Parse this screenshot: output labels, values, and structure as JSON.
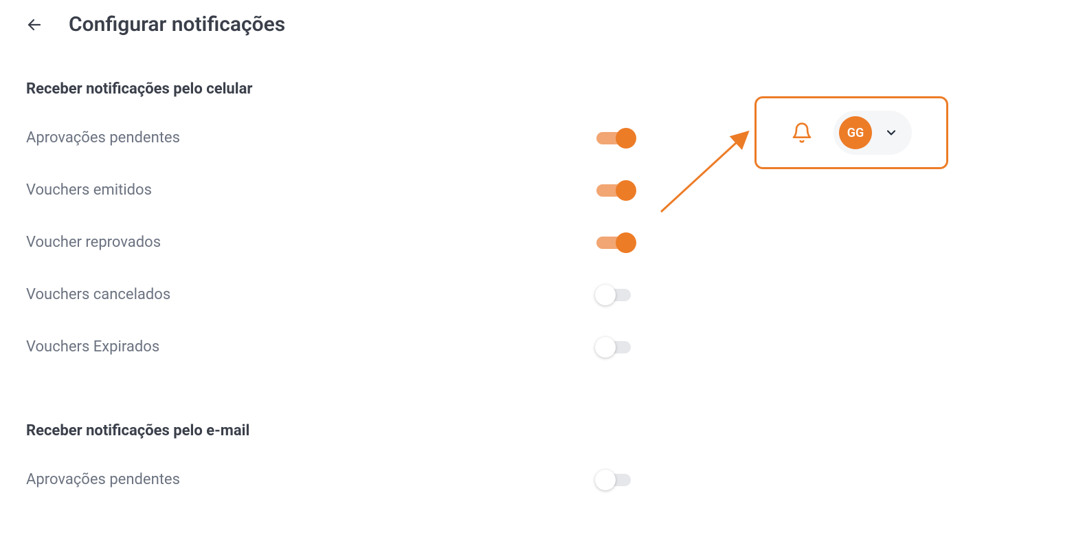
{
  "header": {
    "title": "Configurar notificações"
  },
  "sections": {
    "mobile": {
      "heading": "Receber notificações pelo celular",
      "items": [
        {
          "label": "Aprovações pendentes",
          "on": true
        },
        {
          "label": "Vouchers emitidos",
          "on": true
        },
        {
          "label": "Voucher reprovados",
          "on": true
        },
        {
          "label": "Vouchers cancelados",
          "on": false
        },
        {
          "label": "Vouchers Expirados",
          "on": false
        }
      ]
    },
    "email": {
      "heading": "Receber notificações pelo e-mail",
      "items": [
        {
          "label": "Aprovações pendentes",
          "on": false
        }
      ]
    }
  },
  "profile": {
    "initials": "GG"
  },
  "colors": {
    "accent": "#ed7c27"
  }
}
